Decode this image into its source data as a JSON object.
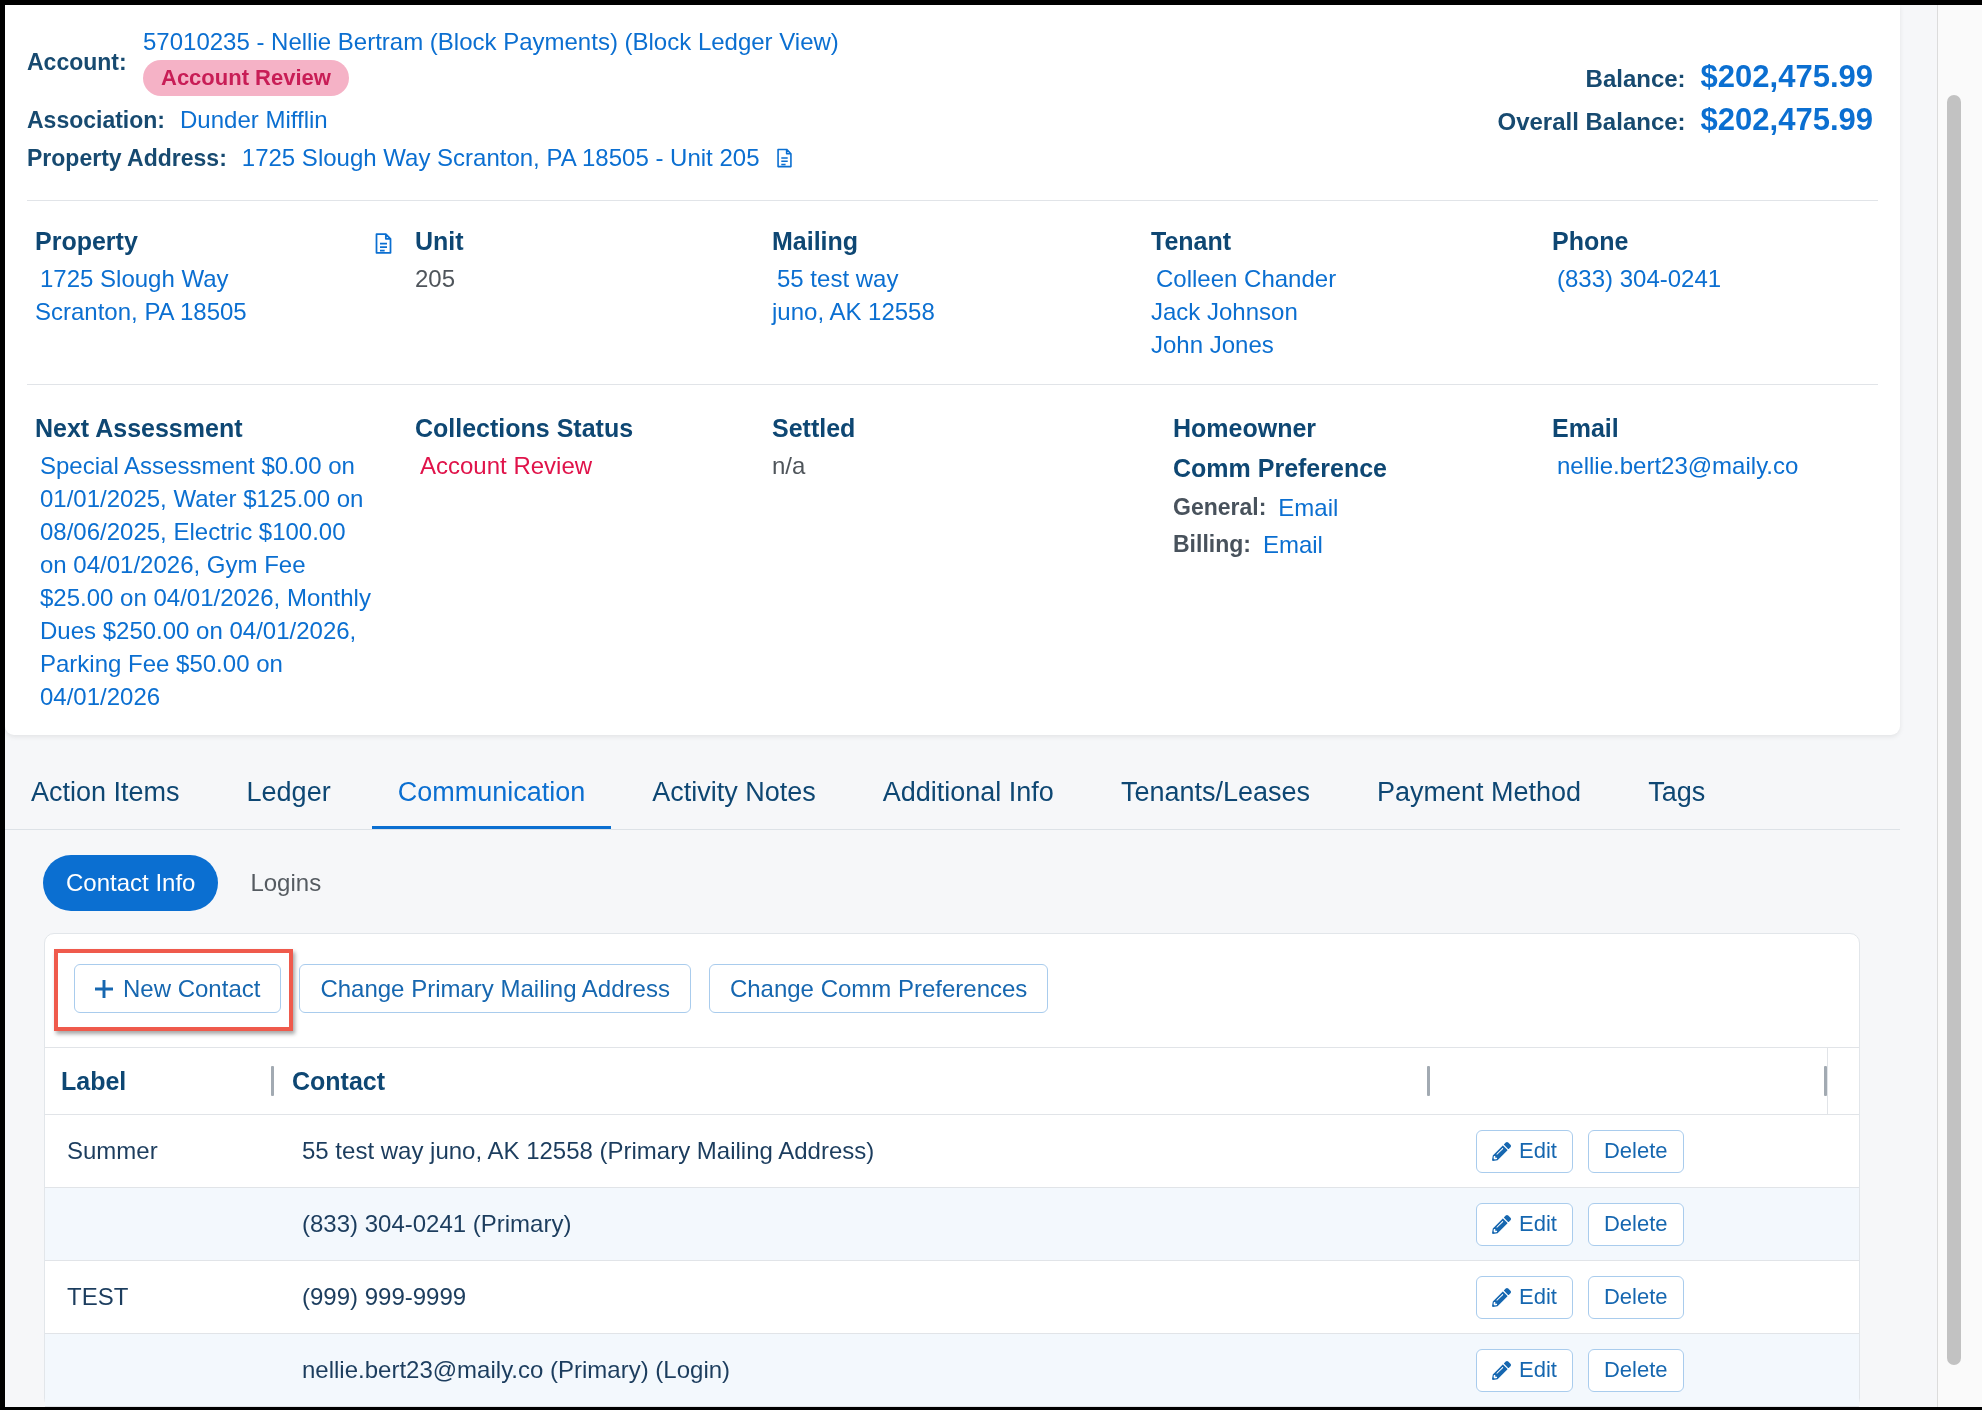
{
  "account": {
    "label": "Account:",
    "name": "57010235 - Nellie Bertram (Block Payments) (Block Ledger View)",
    "status_badge": "Account Review"
  },
  "association": {
    "label": "Association:",
    "value": "Dunder Mifflin"
  },
  "property_address": {
    "label": "Property Address:",
    "value": "1725 Slough Way Scranton, PA 18505 - Unit 205",
    "document": true
  },
  "balances": [
    {
      "label": "Balance:",
      "amount": "$202,475.99"
    },
    {
      "label": "Overall Balance:",
      "amount": "$202,475.99"
    }
  ],
  "details": [
    {
      "fields": [
        {
          "headings": [
            "Property"
          ],
          "kind": "link",
          "lines": [
            "1725 Slough Way",
            "Scranton, PA 18505"
          ],
          "document": true
        },
        {
          "headings": [
            "Unit"
          ],
          "kind": "plain",
          "lines": [
            "205"
          ]
        },
        {
          "headings": [
            "Mailing"
          ],
          "kind": "link",
          "lines": [
            "55 test way",
            "juno, AK 12558"
          ]
        },
        {
          "headings": [
            "Tenant"
          ],
          "kind": "link",
          "lines": [
            "Colleen Chander",
            "Jack Johnson",
            "John Jones"
          ]
        },
        {
          "headings": [
            "Phone"
          ],
          "kind": "link",
          "lines": [
            "(833) 304-0241"
          ]
        }
      ]
    },
    {
      "fields": [
        {
          "headings": [
            "Next Assessment"
          ],
          "kind": "link",
          "lines": [
            "Special Assessment $0.00 on 01/01/2025, Water $125.00 on 08/06/2025, Electric $100.00 on 04/01/2026, Gym Fee $25.00 on 04/01/2026, Monthly Dues $250.00 on 04/01/2026, Parking Fee $50.00 on 04/01/2026"
          ]
        },
        {
          "headings": [
            "Collections Status"
          ],
          "kind": "alert",
          "lines": [
            "Account Review"
          ]
        },
        {
          "headings": [
            "Settled"
          ],
          "kind": "plain",
          "lines": [
            "n/a"
          ]
        },
        {
          "headings": [
            "Homeowner",
            "Comm Preference"
          ],
          "kind": "preferences",
          "preferences": [
            {
              "label": "General:",
              "value": "Email"
            },
            {
              "label": "Billing:",
              "value": "Email"
            }
          ]
        },
        {
          "headings": [
            "Email"
          ],
          "kind": "link",
          "lines": [
            "nellie.bert23@maily.co"
          ]
        }
      ]
    }
  ],
  "tabs": [
    {
      "label": "Action Items",
      "selected": false
    },
    {
      "label": "Ledger",
      "selected": false
    },
    {
      "label": "Communication",
      "selected": true
    },
    {
      "label": "Activity Notes",
      "selected": false
    },
    {
      "label": "Additional Info",
      "selected": false
    },
    {
      "label": "Tenants/Leases",
      "selected": false
    },
    {
      "label": "Payment Method",
      "selected": false
    },
    {
      "label": "Tags",
      "selected": false
    }
  ],
  "subtabs": [
    {
      "label": "Contact Info",
      "selected": true
    },
    {
      "label": "Logins",
      "selected": false
    }
  ],
  "toolbar": [
    {
      "label": "New Contact",
      "kind": "add",
      "highlighted": true
    },
    {
      "label": "Change Primary Mailing Address",
      "kind": "plain",
      "highlighted": false
    },
    {
      "label": "Change Comm Preferences",
      "kind": "plain",
      "highlighted": false
    }
  ],
  "table": {
    "columns": [
      "Label",
      "Contact"
    ],
    "rows": [
      {
        "label": "Summer",
        "contact": "55 test way juno, AK 12558 (Primary Mailing Address)",
        "edit": "Edit",
        "delete": "Delete"
      },
      {
        "contact": "(833) 304-0241 (Primary)",
        "edit": "Edit",
        "delete": "Delete"
      },
      {
        "label": "TEST",
        "contact": "(999) 999-9999",
        "edit": "Edit",
        "delete": "Delete"
      },
      {
        "contact": "nellie.bert23@maily.co (Primary) (Login)",
        "edit": "Edit",
        "delete": "Delete"
      }
    ]
  }
}
